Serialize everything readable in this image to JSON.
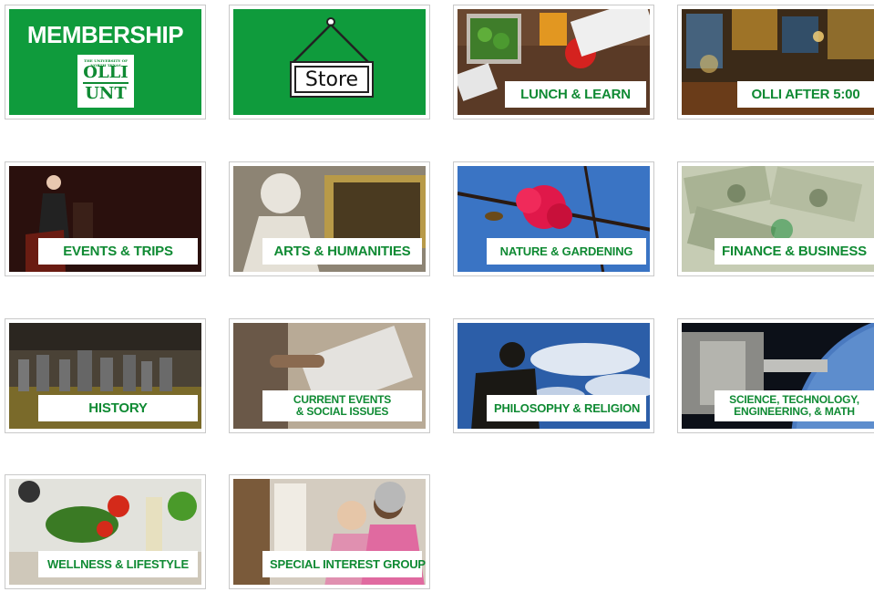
{
  "tiles": [
    {
      "id": "membership",
      "title": "MEMBERSHIP",
      "logo_line1": "OLLI",
      "logo_line2": "UNT",
      "logo_small": "THE UNIVERSITY OF NORTH TEXAS"
    },
    {
      "id": "store",
      "label": "Store"
    },
    {
      "id": "lunch",
      "label": "LUNCH & LEARN"
    },
    {
      "id": "after5",
      "label": "OLLI AFTER 5:00"
    },
    {
      "id": "events",
      "label": "EVENTS & TRIPS"
    },
    {
      "id": "arts",
      "label": "ARTS & HUMANITIES"
    },
    {
      "id": "nature",
      "label": "NATURE & GARDENING"
    },
    {
      "id": "finance",
      "label": "FINANCE & BUSINESS"
    },
    {
      "id": "history",
      "label": "HISTORY"
    },
    {
      "id": "current",
      "label_line1": "CURRENT EVENTS",
      "label_line2": "& SOCIAL ISSUES"
    },
    {
      "id": "philosophy",
      "label": "PHILOSOPHY & RELIGION"
    },
    {
      "id": "stem",
      "label_line1": "SCIENCE, TECHNOLOGY,",
      "label_line2": "ENGINEERING, & MATH"
    },
    {
      "id": "wellness",
      "label": "WELLNESS & LIFESTYLE"
    },
    {
      "id": "sig",
      "label": "SPECIAL INTEREST GROUPS"
    }
  ],
  "colors": {
    "brand_green": "#0f9b3c",
    "label_text": "#0f8a33"
  }
}
